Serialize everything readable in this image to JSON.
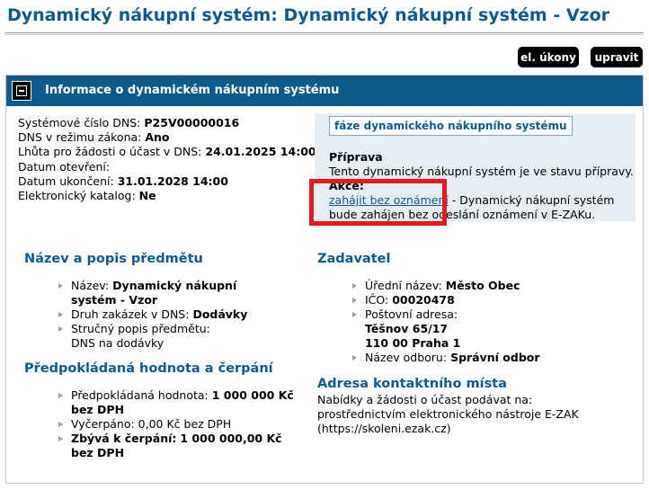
{
  "page": {
    "title": "Dynamický nákupní systém: Dynamický nákupní systém - Vzor"
  },
  "toolbar": {
    "el_ukony_label": "el. úkony",
    "upravit_label": "upravit"
  },
  "panel": {
    "title": "Informace o dynamickém nákupním systému",
    "header_color": "#0f5a8c"
  },
  "info": {
    "system_number_label": "Systémové číslo DNS:",
    "system_number_value": "P25V00000016",
    "law_mode_label": "DNS v režimu zákona:",
    "law_mode_value": "Ano",
    "deadline_label": "Lhůta pro žádosti o účast v DNS:",
    "deadline_value": "24.01.2025 14:00",
    "opened_label": "Datum otevření:",
    "opened_value": "",
    "closed_label": "Datum ukončení:",
    "closed_value": "31.01.2028 14:00",
    "catalog_label": "Elektronický katalog:",
    "catalog_value": "Ne"
  },
  "phase": {
    "box_label": "fáze dynamického nákupního systému",
    "name": "Příprava",
    "description": "Tento dynamický nákupní systém je ve stavu přípravy.",
    "actions_label": "Akce:",
    "action_link": "zahájit bez oznámení",
    "action_desc": " - Dynamický nákupní systém bude zahájen bez odeslání oznámení v E-ZAKu."
  },
  "subject": {
    "title": "Název a popis předmětu",
    "name_label": "Název:",
    "name_value": "Dynamický nákupní systém - Vzor",
    "type_label": "Druh zakázek v DNS:",
    "type_value": "Dodávky",
    "short_desc_label": "Stručný popis předmětu:",
    "short_desc_value": "DNS na dodávky"
  },
  "value": {
    "title": "Předpokládaná hodnota a čerpání",
    "expected_label": "Předpokládaná hodnota:",
    "expected_value": "1 000 000 Kč bez DPH",
    "spent_text": "Vyčerpáno: 0,00 Kč bez DPH",
    "remaining_label": "Zbývá k čerpání:",
    "remaining_value": "1 000 000,00 Kč bez DPH"
  },
  "contracting": {
    "title": "Zadavatel",
    "official_name_label": "Úřední název:",
    "official_name_value": "Město Obec",
    "ico_label": "IČO:",
    "ico_value": "00020478",
    "postal_label": "Poštovní adresa:",
    "postal_line1": "Těšnov 65/17",
    "postal_line2": "110 00 Praha 1",
    "department_label": "Název odboru:",
    "department_value": "Správní odbor"
  },
  "contact": {
    "title": "Adresa kontaktního místa",
    "line1": "Nabídky a žádosti o účast podávat na:",
    "line2": "prostřednictvím elektronického nástroje E-ZAK",
    "line3": "(https://skoleni.ezak.cz)"
  }
}
